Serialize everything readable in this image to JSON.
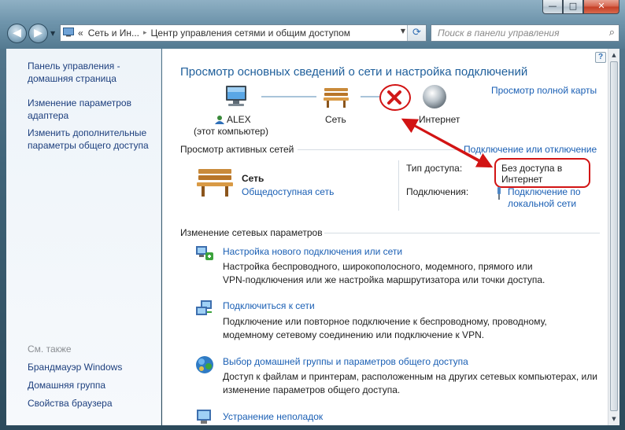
{
  "window": {
    "controls": {
      "minimize": "—",
      "maximize": "□",
      "close": "✕"
    }
  },
  "nav": {
    "back": "◀",
    "forward": "▶",
    "address": {
      "crumb_1": "Сеть и Ин...",
      "crumb_2": "Центр управления сетями и общим доступом",
      "separator": "▸",
      "root_marker": "«"
    },
    "search_placeholder": "Поиск в панели управления"
  },
  "sidebar": {
    "items": [
      {
        "label": "Панель управления -\nдомашняя страница"
      },
      {
        "label": "Изменение параметров\nадаптера"
      },
      {
        "label": "Изменить дополнительные\nпараметры общего доступа"
      }
    ],
    "see_also_title": "См. также",
    "see_also": [
      {
        "label": "Брандмауэр Windows"
      },
      {
        "label": "Домашняя группа"
      },
      {
        "label": "Свойства браузера"
      }
    ]
  },
  "main": {
    "title": "Просмотр основных сведений о сети и настройка подключений",
    "full_map_link": "Просмотр полной карты",
    "map": {
      "computer_name": "ALEX",
      "computer_sub": "(этот компьютер)",
      "network": "Сеть",
      "internet": "Интернет"
    },
    "active": {
      "section_title": "Просмотр активных сетей",
      "connect_link": "Подключение или отключение",
      "network_name": "Сеть",
      "network_type": "Общедоступная сеть",
      "access_label": "Тип доступа:",
      "access_value": "Без доступа в\nИнтернет",
      "connections_label": "Подключения:",
      "connections_value": "Подключение по\nлокальной сети"
    },
    "change": {
      "section_title": "Изменение сетевых параметров",
      "tasks": [
        {
          "link": "Настройка нового подключения или сети",
          "desc": "Настройка беспроводного, широкополосного, модемного, прямого или\nVPN-подключения или же настройка маршрутизатора или точки доступа."
        },
        {
          "link": "Подключиться к сети",
          "desc": "Подключение или повторное подключение к беспроводному, проводному,\nмодемному сетевому соединению или подключение к VPN."
        },
        {
          "link": "Выбор домашней группы и параметров общего доступа",
          "desc": "Доступ к файлам и принтерам, расположенным на других сетевых компьютерах, или\nизменение параметров общего доступа."
        },
        {
          "link": "Устранение неполадок",
          "desc": ""
        }
      ]
    }
  },
  "help": "?",
  "colors": {
    "link": "#1a5fb4",
    "title": "#1f5f9b",
    "annotation": "#d21414"
  }
}
